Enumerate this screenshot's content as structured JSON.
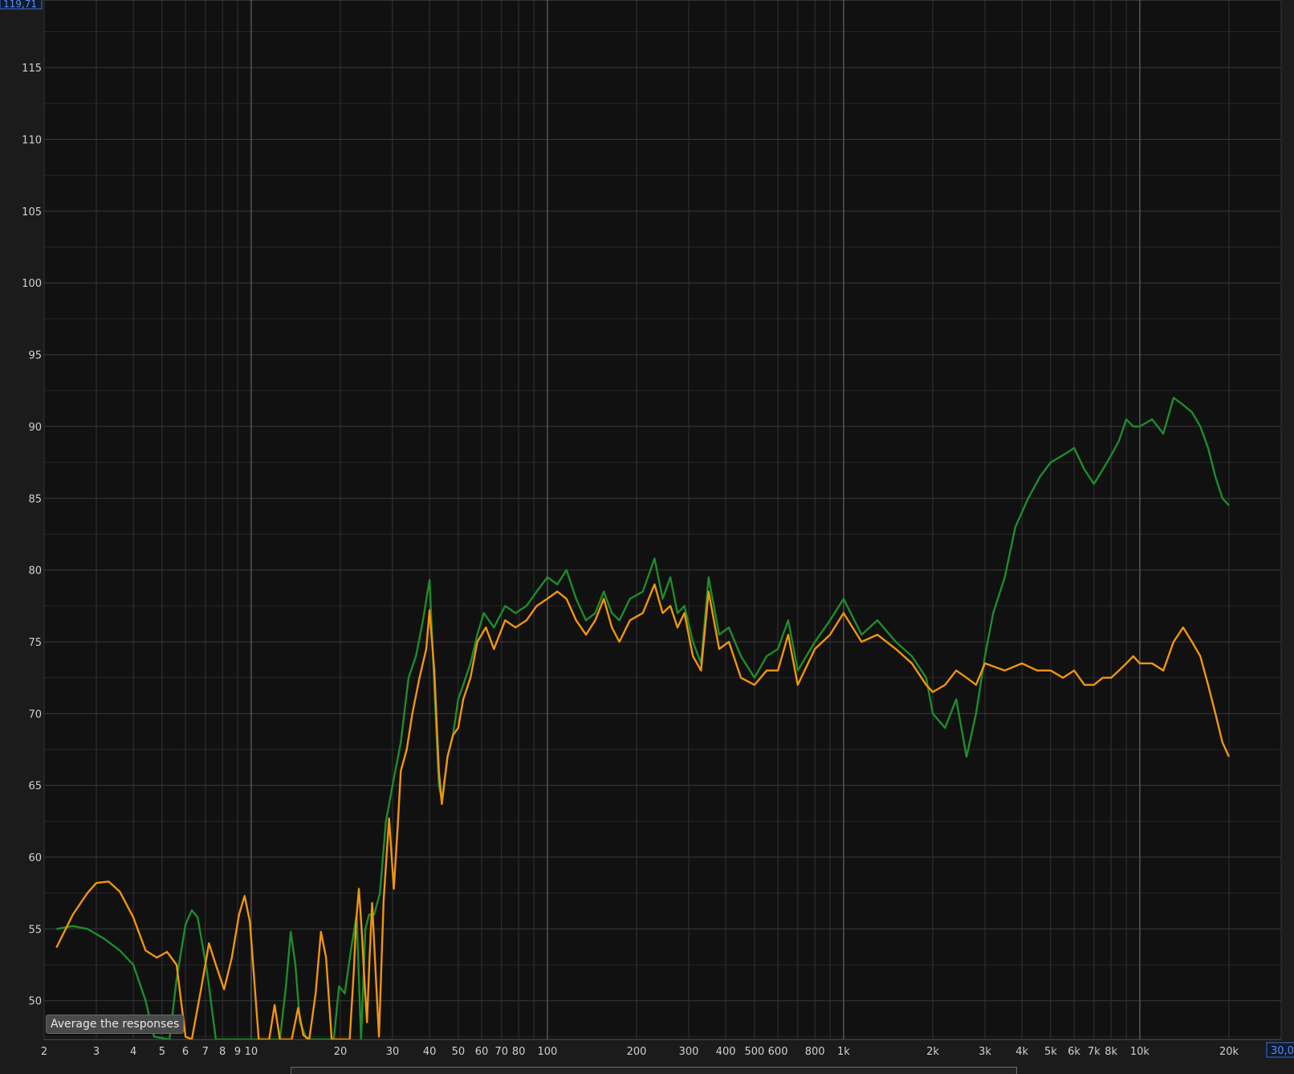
{
  "chart_data": {
    "type": "line",
    "x_scale": "log",
    "xlim": [
      2,
      30000
    ],
    "ylim": [
      47.3,
      119.71
    ],
    "grid": true,
    "y_top_readout": "119,71",
    "x_right_readout": "30,0",
    "yticks": [
      50,
      55,
      60,
      65,
      70,
      75,
      80,
      85,
      90,
      95,
      100,
      105,
      110,
      115
    ],
    "xticks": [
      {
        "v": 2,
        "label": "2"
      },
      {
        "v": 3,
        "label": "3"
      },
      {
        "v": 4,
        "label": "4"
      },
      {
        "v": 5,
        "label": "5"
      },
      {
        "v": 6,
        "label": "6"
      },
      {
        "v": 7,
        "label": "7"
      },
      {
        "v": 8,
        "label": "8"
      },
      {
        "v": 9,
        "label": "9"
      },
      {
        "v": 10,
        "label": "10"
      },
      {
        "v": 20,
        "label": "20"
      },
      {
        "v": 30,
        "label": "30"
      },
      {
        "v": 40,
        "label": "40"
      },
      {
        "v": 50,
        "label": "50"
      },
      {
        "v": 60,
        "label": "60"
      },
      {
        "v": 70,
        "label": "70"
      },
      {
        "v": 80,
        "label": "80"
      },
      {
        "v": 100,
        "label": "100"
      },
      {
        "v": 200,
        "label": "200"
      },
      {
        "v": 300,
        "label": "300"
      },
      {
        "v": 400,
        "label": "400"
      },
      {
        "v": 500,
        "label": "500"
      },
      {
        "v": 600,
        "label": "600"
      },
      {
        "v": 800,
        "label": "800"
      },
      {
        "v": 1000,
        "label": "1k"
      },
      {
        "v": 2000,
        "label": "2k"
      },
      {
        "v": 3000,
        "label": "3k"
      },
      {
        "v": 4000,
        "label": "4k"
      },
      {
        "v": 5000,
        "label": "5k"
      },
      {
        "v": 6000,
        "label": "6k"
      },
      {
        "v": 7000,
        "label": "7k"
      },
      {
        "v": 8000,
        "label": "8k"
      },
      {
        "v": 10000,
        "label": "10k"
      },
      {
        "v": 20000,
        "label": "20k"
      }
    ],
    "series": [
      {
        "color": "#1e8c2c",
        "points": [
          [
            2.2,
            55.0
          ],
          [
            2.5,
            55.2
          ],
          [
            2.8,
            55.0
          ],
          [
            3.2,
            54.3
          ],
          [
            3.6,
            53.5
          ],
          [
            4.0,
            52.5
          ],
          [
            4.4,
            50.0
          ],
          [
            4.7,
            47.5
          ],
          [
            5.3,
            47.3
          ],
          [
            5.6,
            51.5
          ],
          [
            6.0,
            55.3
          ],
          [
            6.3,
            56.3
          ],
          [
            6.6,
            55.8
          ],
          [
            7.1,
            52.0
          ],
          [
            7.6,
            47.3
          ],
          [
            12.5,
            47.3
          ],
          [
            13.1,
            51.0
          ],
          [
            13.6,
            54.8
          ],
          [
            14.1,
            52.5
          ],
          [
            14.6,
            48.5
          ],
          [
            15.4,
            47.3
          ],
          [
            19.0,
            47.3
          ],
          [
            19.8,
            51.0
          ],
          [
            20.7,
            50.5
          ],
          [
            21.7,
            53.5
          ],
          [
            22.7,
            56.0
          ],
          [
            23.5,
            47.3
          ],
          [
            24.3,
            55.0
          ],
          [
            25.0,
            56.0
          ],
          [
            26.0,
            56.0
          ],
          [
            27.2,
            57.5
          ],
          [
            28.5,
            62.5
          ],
          [
            30.0,
            65.0
          ],
          [
            32.0,
            68.0
          ],
          [
            34.0,
            72.5
          ],
          [
            36.0,
            74.0
          ],
          [
            38.0,
            76.5
          ],
          [
            40.0,
            79.3
          ],
          [
            41.5,
            72.0
          ],
          [
            43.0,
            65.0
          ],
          [
            44.0,
            64.0
          ],
          [
            46.0,
            67.0
          ],
          [
            48.0,
            68.5
          ],
          [
            50.0,
            71.0
          ],
          [
            52.0,
            72.0
          ],
          [
            55.0,
            73.5
          ],
          [
            58.0,
            75.5
          ],
          [
            61.0,
            77.0
          ],
          [
            66.0,
            76.0
          ],
          [
            72.0,
            77.5
          ],
          [
            78.0,
            77.0
          ],
          [
            85.0,
            77.5
          ],
          [
            92.0,
            78.5
          ],
          [
            100.0,
            79.5
          ],
          [
            108.0,
            79.0
          ],
          [
            116.0,
            80.0
          ],
          [
            125.0,
            78.0
          ],
          [
            135.0,
            76.5
          ],
          [
            145.0,
            77.0
          ],
          [
            155.0,
            78.5
          ],
          [
            165.0,
            77.0
          ],
          [
            175.0,
            76.5
          ],
          [
            190.0,
            78.0
          ],
          [
            210.0,
            78.5
          ],
          [
            230.0,
            80.8
          ],
          [
            245.0,
            78.0
          ],
          [
            260.0,
            79.5
          ],
          [
            275.0,
            77.0
          ],
          [
            290.0,
            77.5
          ],
          [
            310.0,
            75.0
          ],
          [
            330.0,
            73.5
          ],
          [
            350.0,
            79.5
          ],
          [
            380.0,
            75.5
          ],
          [
            410.0,
            76.0
          ],
          [
            450.0,
            74.0
          ],
          [
            500.0,
            72.5
          ],
          [
            550.0,
            74.0
          ],
          [
            600.0,
            74.5
          ],
          [
            650.0,
            76.5
          ],
          [
            700.0,
            73.0
          ],
          [
            800.0,
            75.0
          ],
          [
            900.0,
            76.5
          ],
          [
            1000.0,
            78.0
          ],
          [
            1150.0,
            75.5
          ],
          [
            1300.0,
            76.5
          ],
          [
            1500.0,
            75.0
          ],
          [
            1700.0,
            74.0
          ],
          [
            1900.0,
            72.5
          ],
          [
            2000.0,
            70.0
          ],
          [
            2200.0,
            69.0
          ],
          [
            2400.0,
            71.0
          ],
          [
            2600.0,
            67.0
          ],
          [
            2800.0,
            70.0
          ],
          [
            3000.0,
            74.0
          ],
          [
            3200.0,
            77.0
          ],
          [
            3500.0,
            79.5
          ],
          [
            3800.0,
            83.0
          ],
          [
            4200.0,
            85.0
          ],
          [
            4600.0,
            86.5
          ],
          [
            5000.0,
            87.5
          ],
          [
            5500.0,
            88.0
          ],
          [
            6000.0,
            88.5
          ],
          [
            6500.0,
            87.0
          ],
          [
            7000.0,
            86.0
          ],
          [
            7500.0,
            87.0
          ],
          [
            8000.0,
            88.0
          ],
          [
            8500.0,
            89.0
          ],
          [
            9000.0,
            90.5
          ],
          [
            9500.0,
            90.0
          ],
          [
            10000.0,
            90.0
          ],
          [
            11000.0,
            90.5
          ],
          [
            12000.0,
            89.5
          ],
          [
            13000.0,
            92.0
          ],
          [
            14000.0,
            91.5
          ],
          [
            15000.0,
            91.0
          ],
          [
            16000.0,
            90.0
          ],
          [
            17000.0,
            88.5
          ],
          [
            18000.0,
            86.5
          ],
          [
            19000.0,
            85.0
          ],
          [
            20000.0,
            84.5
          ]
        ]
      },
      {
        "color": "#f0950f",
        "points": [
          [
            2.2,
            53.7
          ],
          [
            2.5,
            56.0
          ],
          [
            2.8,
            57.5
          ],
          [
            3.0,
            58.2
          ],
          [
            3.3,
            58.3
          ],
          [
            3.6,
            57.6
          ],
          [
            4.0,
            55.8
          ],
          [
            4.4,
            53.5
          ],
          [
            4.8,
            53.0
          ],
          [
            5.2,
            53.4
          ],
          [
            5.6,
            52.5
          ],
          [
            6.0,
            47.5
          ],
          [
            6.3,
            47.3
          ],
          [
            6.8,
            51.0
          ],
          [
            7.2,
            54.0
          ],
          [
            7.6,
            52.5
          ],
          [
            8.1,
            50.8
          ],
          [
            8.6,
            53.0
          ],
          [
            9.1,
            56.0
          ],
          [
            9.5,
            57.3
          ],
          [
            9.9,
            55.5
          ],
          [
            10.6,
            47.3
          ],
          [
            11.5,
            47.3
          ],
          [
            12.0,
            49.7
          ],
          [
            12.5,
            47.3
          ],
          [
            13.7,
            47.3
          ],
          [
            14.4,
            49.5
          ],
          [
            15.0,
            47.6
          ],
          [
            15.7,
            47.3
          ],
          [
            16.5,
            50.5
          ],
          [
            17.2,
            54.8
          ],
          [
            17.9,
            53.0
          ],
          [
            18.7,
            47.3
          ],
          [
            21.5,
            47.3
          ],
          [
            22.2,
            52.0
          ],
          [
            22.6,
            55.5
          ],
          [
            23.1,
            57.8
          ],
          [
            23.6,
            55.0
          ],
          [
            24.1,
            51.5
          ],
          [
            24.6,
            48.5
          ],
          [
            25.1,
            53.0
          ],
          [
            25.6,
            56.8
          ],
          [
            26.3,
            52.0
          ],
          [
            27.0,
            47.5
          ],
          [
            28.0,
            57.0
          ],
          [
            29.2,
            62.7
          ],
          [
            30.3,
            57.8
          ],
          [
            31.2,
            62.0
          ],
          [
            32.0,
            66.0
          ],
          [
            33.5,
            67.5
          ],
          [
            35.0,
            70.0
          ],
          [
            37.0,
            72.5
          ],
          [
            39.0,
            74.5
          ],
          [
            40.0,
            77.2
          ],
          [
            41.5,
            73.0
          ],
          [
            43.0,
            66.0
          ],
          [
            44.0,
            63.7
          ],
          [
            46.0,
            67.0
          ],
          [
            48.0,
            68.5
          ],
          [
            50.0,
            69.0
          ],
          [
            52.0,
            71.0
          ],
          [
            55.0,
            72.5
          ],
          [
            58.0,
            75.0
          ],
          [
            62.0,
            76.0
          ],
          [
            66.0,
            74.5
          ],
          [
            72.0,
            76.5
          ],
          [
            78.0,
            76.0
          ],
          [
            85.0,
            76.5
          ],
          [
            92.0,
            77.5
          ],
          [
            100.0,
            78.0
          ],
          [
            108.0,
            78.5
          ],
          [
            116.0,
            78.0
          ],
          [
            125.0,
            76.5
          ],
          [
            135.0,
            75.5
          ],
          [
            145.0,
            76.5
          ],
          [
            155.0,
            78.0
          ],
          [
            165.0,
            76.0
          ],
          [
            175.0,
            75.0
          ],
          [
            190.0,
            76.5
          ],
          [
            210.0,
            77.0
          ],
          [
            230.0,
            79.0
          ],
          [
            245.0,
            77.0
          ],
          [
            260.0,
            77.5
          ],
          [
            275.0,
            76.0
          ],
          [
            290.0,
            77.0
          ],
          [
            310.0,
            74.0
          ],
          [
            330.0,
            73.0
          ],
          [
            350.0,
            78.5
          ],
          [
            380.0,
            74.5
          ],
          [
            410.0,
            75.0
          ],
          [
            450.0,
            72.5
          ],
          [
            500.0,
            72.0
          ],
          [
            550.0,
            73.0
          ],
          [
            600.0,
            73.0
          ],
          [
            650.0,
            75.5
          ],
          [
            700.0,
            72.0
          ],
          [
            800.0,
            74.5
          ],
          [
            900.0,
            75.5
          ],
          [
            1000.0,
            77.0
          ],
          [
            1150.0,
            75.0
          ],
          [
            1300.0,
            75.5
          ],
          [
            1500.0,
            74.5
          ],
          [
            1700.0,
            73.5
          ],
          [
            1900.0,
            72.0
          ],
          [
            2000.0,
            71.5
          ],
          [
            2200.0,
            72.0
          ],
          [
            2400.0,
            73.0
          ],
          [
            2600.0,
            72.5
          ],
          [
            2800.0,
            72.0
          ],
          [
            3000.0,
            73.5
          ],
          [
            3500.0,
            73.0
          ],
          [
            4000.0,
            73.5
          ],
          [
            4500.0,
            73.0
          ],
          [
            5000.0,
            73.0
          ],
          [
            5500.0,
            72.5
          ],
          [
            6000.0,
            73.0
          ],
          [
            6500.0,
            72.0
          ],
          [
            7000.0,
            72.0
          ],
          [
            7500.0,
            72.5
          ],
          [
            8000.0,
            72.5
          ],
          [
            8500.0,
            73.0
          ],
          [
            9000.0,
            73.5
          ],
          [
            9500.0,
            74.0
          ],
          [
            10000.0,
            73.5
          ],
          [
            11000.0,
            73.5
          ],
          [
            12000.0,
            73.0
          ],
          [
            13000.0,
            75.0
          ],
          [
            14000.0,
            76.0
          ],
          [
            15000.0,
            75.0
          ],
          [
            16000.0,
            74.0
          ],
          [
            17000.0,
            72.0
          ],
          [
            18000.0,
            70.0
          ],
          [
            19000.0,
            68.0
          ],
          [
            20000.0,
            67.0
          ]
        ]
      }
    ]
  },
  "tooltip_text": "Average the responses"
}
